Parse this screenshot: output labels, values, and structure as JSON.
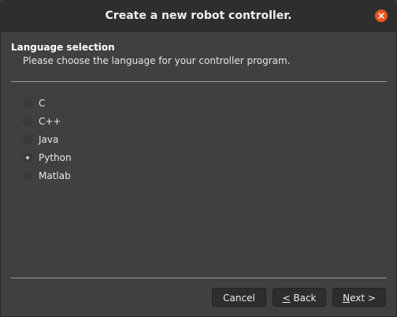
{
  "window": {
    "title": "Create a new robot controller.",
    "accent_color": "#e95420"
  },
  "header": {
    "heading": "Language selection",
    "subheading": "Please choose the language for your controller program."
  },
  "languages": {
    "selected": "Python",
    "options": [
      {
        "label": "C",
        "checked": false
      },
      {
        "label": "C++",
        "checked": false
      },
      {
        "label": "Java",
        "checked": false
      },
      {
        "label": "Python",
        "checked": true
      },
      {
        "label": "Matlab",
        "checked": false
      }
    ]
  },
  "buttons": {
    "cancel": "Cancel",
    "back_mnemonic": "<",
    "back_rest": " Back",
    "next_mnemonic": "N",
    "next_rest": "ext >"
  },
  "icons": {
    "close": "close-icon"
  }
}
